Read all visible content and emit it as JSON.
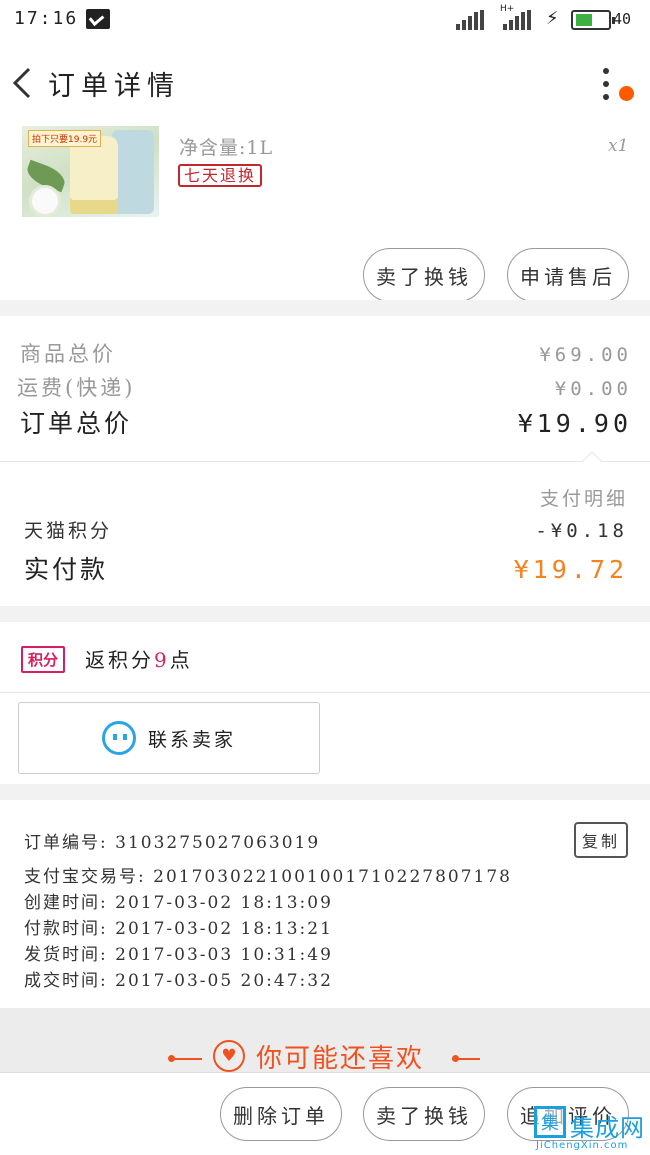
{
  "status_bar": {
    "time": "17:16",
    "battery": "40"
  },
  "header": {
    "title": "订单详情"
  },
  "product": {
    "thumb_tag": "拍下只要19.9元",
    "net_content": "净含量:1L",
    "quantity": "x1",
    "badge": "七天退换"
  },
  "actions_top": {
    "sell_label": "卖了换钱",
    "aftersale_label": "申请售后"
  },
  "price": {
    "goods_total_label": "商品总价",
    "goods_total_value": "¥69.00",
    "shipping_label": "运费(快递)",
    "shipping_value": "¥0.00",
    "order_total_label": "订单总价",
    "order_total_value": "¥19.90",
    "pay_detail_label": "支付明细",
    "points_label": "天猫积分",
    "points_value": "-¥0.18",
    "paid_label": "实付款",
    "paid_value": "¥19.72"
  },
  "points": {
    "tag": "积分",
    "text_prefix": "返积分",
    "count": "9",
    "text_suffix": "点"
  },
  "contact": {
    "label": "联系卖家"
  },
  "order_info": {
    "order_no": "订单编号: 3103275027063019",
    "alipay_no": "支付宝交易号: 2017030221001001710227807178",
    "created": "创建时间: 2017-03-02 18:13:09",
    "paid": "付款时间: 2017-03-02 18:13:21",
    "shipped": "发货时间: 2017-03-03 10:31:49",
    "completed": "成交时间: 2017-03-05 20:47:32",
    "copy_label": "复制"
  },
  "recommend": {
    "title": "你可能还喜欢"
  },
  "bottom_bar": {
    "delete_label": "删除订单",
    "sell_label": "卖了换钱",
    "review_label": "追加评价"
  },
  "watermark": {
    "brand": "集成网",
    "url": "JiChengXin.com"
  },
  "colors": {
    "accent": "#f5821f",
    "points": "#d81e5b",
    "refund": "#c0282e",
    "recommend": "#f0521f"
  }
}
